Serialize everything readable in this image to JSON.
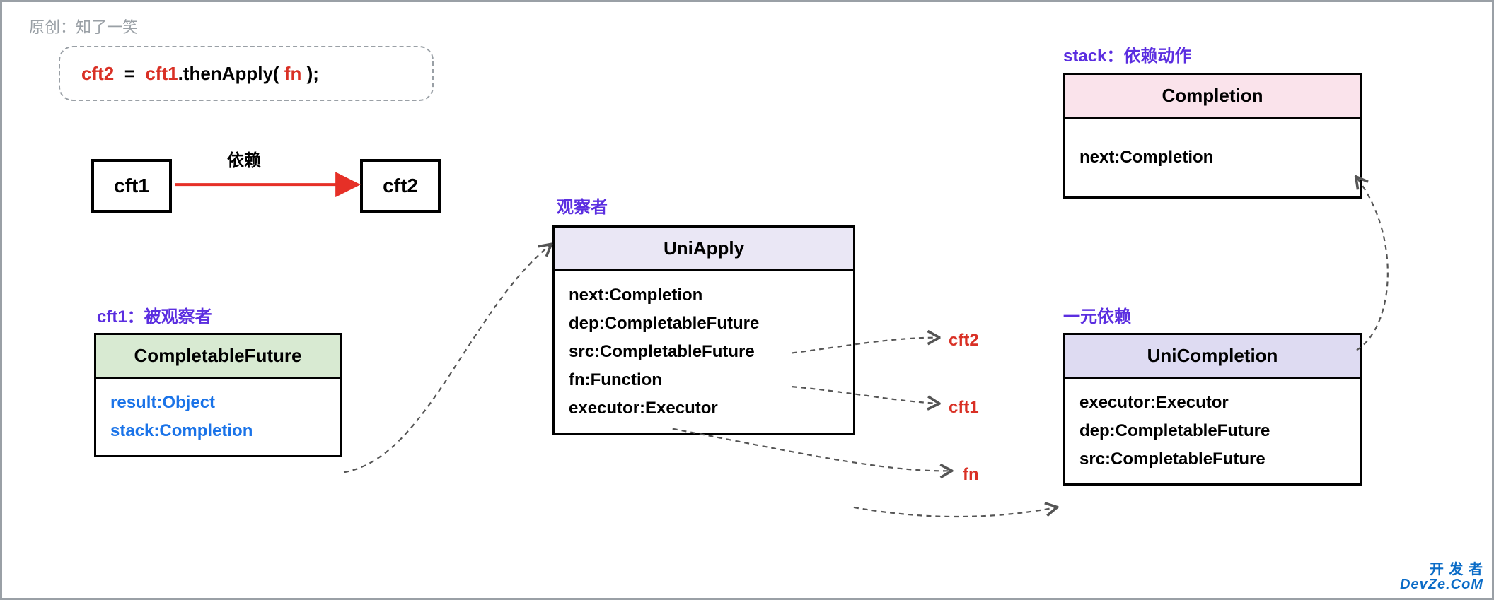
{
  "attribution": "原创：知了一笑",
  "code": {
    "seg1": "cft2",
    "seg2": "  =  ",
    "seg3": "cft1",
    "seg4": ".thenApply( ",
    "seg5": "fn",
    "seg6": " );"
  },
  "small": {
    "cft1": "cft1",
    "cft2": "cft2",
    "depend": "依赖"
  },
  "labels": {
    "cft1_observed": "cft1：被观察者",
    "observer": "观察者",
    "stack_action": "stack：依赖动作",
    "unary_dep": "一元依赖"
  },
  "boxes": {
    "completableFuture": {
      "title": "CompletableFuture",
      "fields": [
        "result:Object",
        "stack:Completion"
      ]
    },
    "uniApply": {
      "title": "UniApply",
      "fields": [
        "next:Completion",
        "dep:CompletableFuture",
        "src:CompletableFuture",
        "fn:Function",
        "executor:Executor"
      ]
    },
    "completion": {
      "title": "Completion",
      "fields": [
        "next:Completion"
      ]
    },
    "uniCompletion": {
      "title": "UniCompletion",
      "fields": [
        "executor:Executor",
        "dep:CompletableFuture",
        "src:CompletableFuture"
      ]
    }
  },
  "targets": {
    "cft2": "cft2",
    "cft1": "cft1",
    "fn": "fn"
  },
  "watermark": {
    "l1": "开 发 者",
    "l2": "DevZe.CoM"
  },
  "colors": {
    "red": "#d93025",
    "arrow_red": "#e63027",
    "purple": "#5b2ee0",
    "blue": "#1a73e8",
    "dash": "#555"
  }
}
